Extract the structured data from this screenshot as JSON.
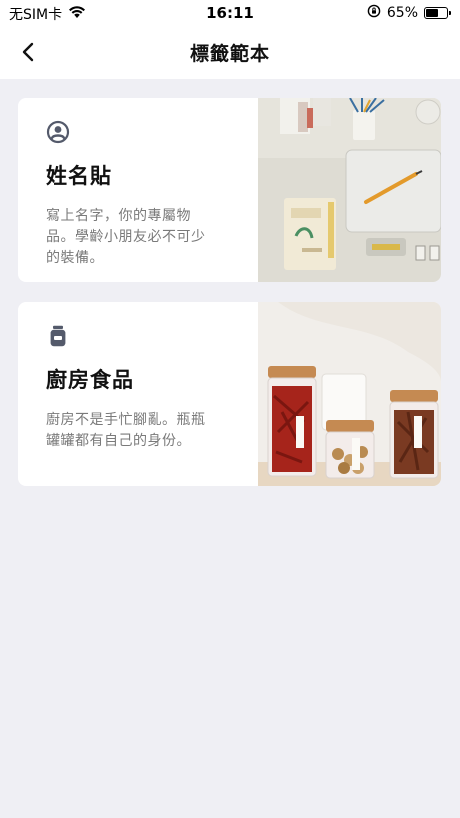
{
  "status_bar": {
    "carrier": "无SIM卡",
    "time": "16:11",
    "battery_percent": "65%",
    "battery_level": 0.65
  },
  "nav": {
    "title": "標籤範本"
  },
  "templates": [
    {
      "title": "姓名貼",
      "description": "寫上名字，你的專屬物品。學齡小朋友必不可少的裝備。",
      "icon": "person-circle-icon"
    },
    {
      "title": "廚房食品",
      "description": "廚房不是手忙腳亂。瓶瓶罐罐都有自己的身份。",
      "icon": "jar-icon"
    }
  ]
}
